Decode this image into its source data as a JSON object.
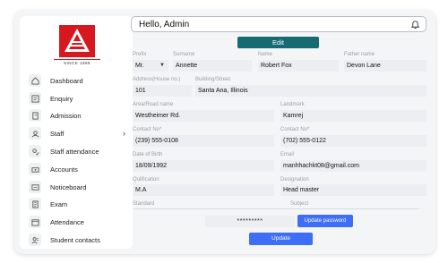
{
  "brand": {
    "since": "SINCE 1999",
    "logo_color": "#d7191f"
  },
  "sidebar": {
    "items": [
      {
        "label": "Dashboard",
        "icon": "home-icon"
      },
      {
        "label": "Enquiry",
        "icon": "enquiry-icon"
      },
      {
        "label": "Admission",
        "icon": "admission-icon"
      },
      {
        "label": "Staff",
        "icon": "staff-icon",
        "has_submenu": true
      },
      {
        "label": "Staff attendance",
        "icon": "staff-attendance-icon"
      },
      {
        "label": "Accounts",
        "icon": "accounts-icon"
      },
      {
        "label": "Noticeboard",
        "icon": "noticeboard-icon"
      },
      {
        "label": "Exam",
        "icon": "exam-icon"
      },
      {
        "label": "Attendance",
        "icon": "attendance-icon"
      },
      {
        "label": "Student contacts",
        "icon": "student-contacts-icon"
      }
    ],
    "chevron": "›"
  },
  "header": {
    "title": "Hello, Admin",
    "icon": "bell-icon"
  },
  "form": {
    "edit_label": "Edit",
    "prefix": {
      "label": "Prefix",
      "value": "Mr."
    },
    "surname": {
      "label": "Surname",
      "value": "Annette"
    },
    "name": {
      "label": "Name",
      "value": "Robert Fox"
    },
    "father_name": {
      "label": "Father name",
      "value": "Devon Lane"
    },
    "address": {
      "label": "Address(House no.)",
      "value": "101"
    },
    "building": {
      "label": "Building/Street",
      "value": "Santa Ana, Illinois"
    },
    "area": {
      "label": "Area/Road name",
      "value": "Westheimer Rd."
    },
    "landmark": {
      "label": "Landmark",
      "value": "Kamrej"
    },
    "contact1": {
      "label": "Contact No*",
      "value": "(239) 555-0108"
    },
    "contact2": {
      "label": "Contact No*",
      "value": "(702) 555-0122"
    },
    "dob": {
      "label": "Date of Birth",
      "value": "18/09/1992"
    },
    "email": {
      "label": "Email",
      "value": "manhhachkt08@gmail.com"
    },
    "qualification": {
      "label": "Qulification",
      "value": "M.A"
    },
    "designation": {
      "label": "Designation",
      "value": "Head master"
    },
    "standard": {
      "label": "Standard"
    },
    "subject": {
      "label": "Subject"
    },
    "password_mask": "*********",
    "update_password_label": "Update password",
    "update_label": "Update"
  },
  "colors": {
    "primary": "#3d6ef5",
    "edit": "#166b73"
  }
}
